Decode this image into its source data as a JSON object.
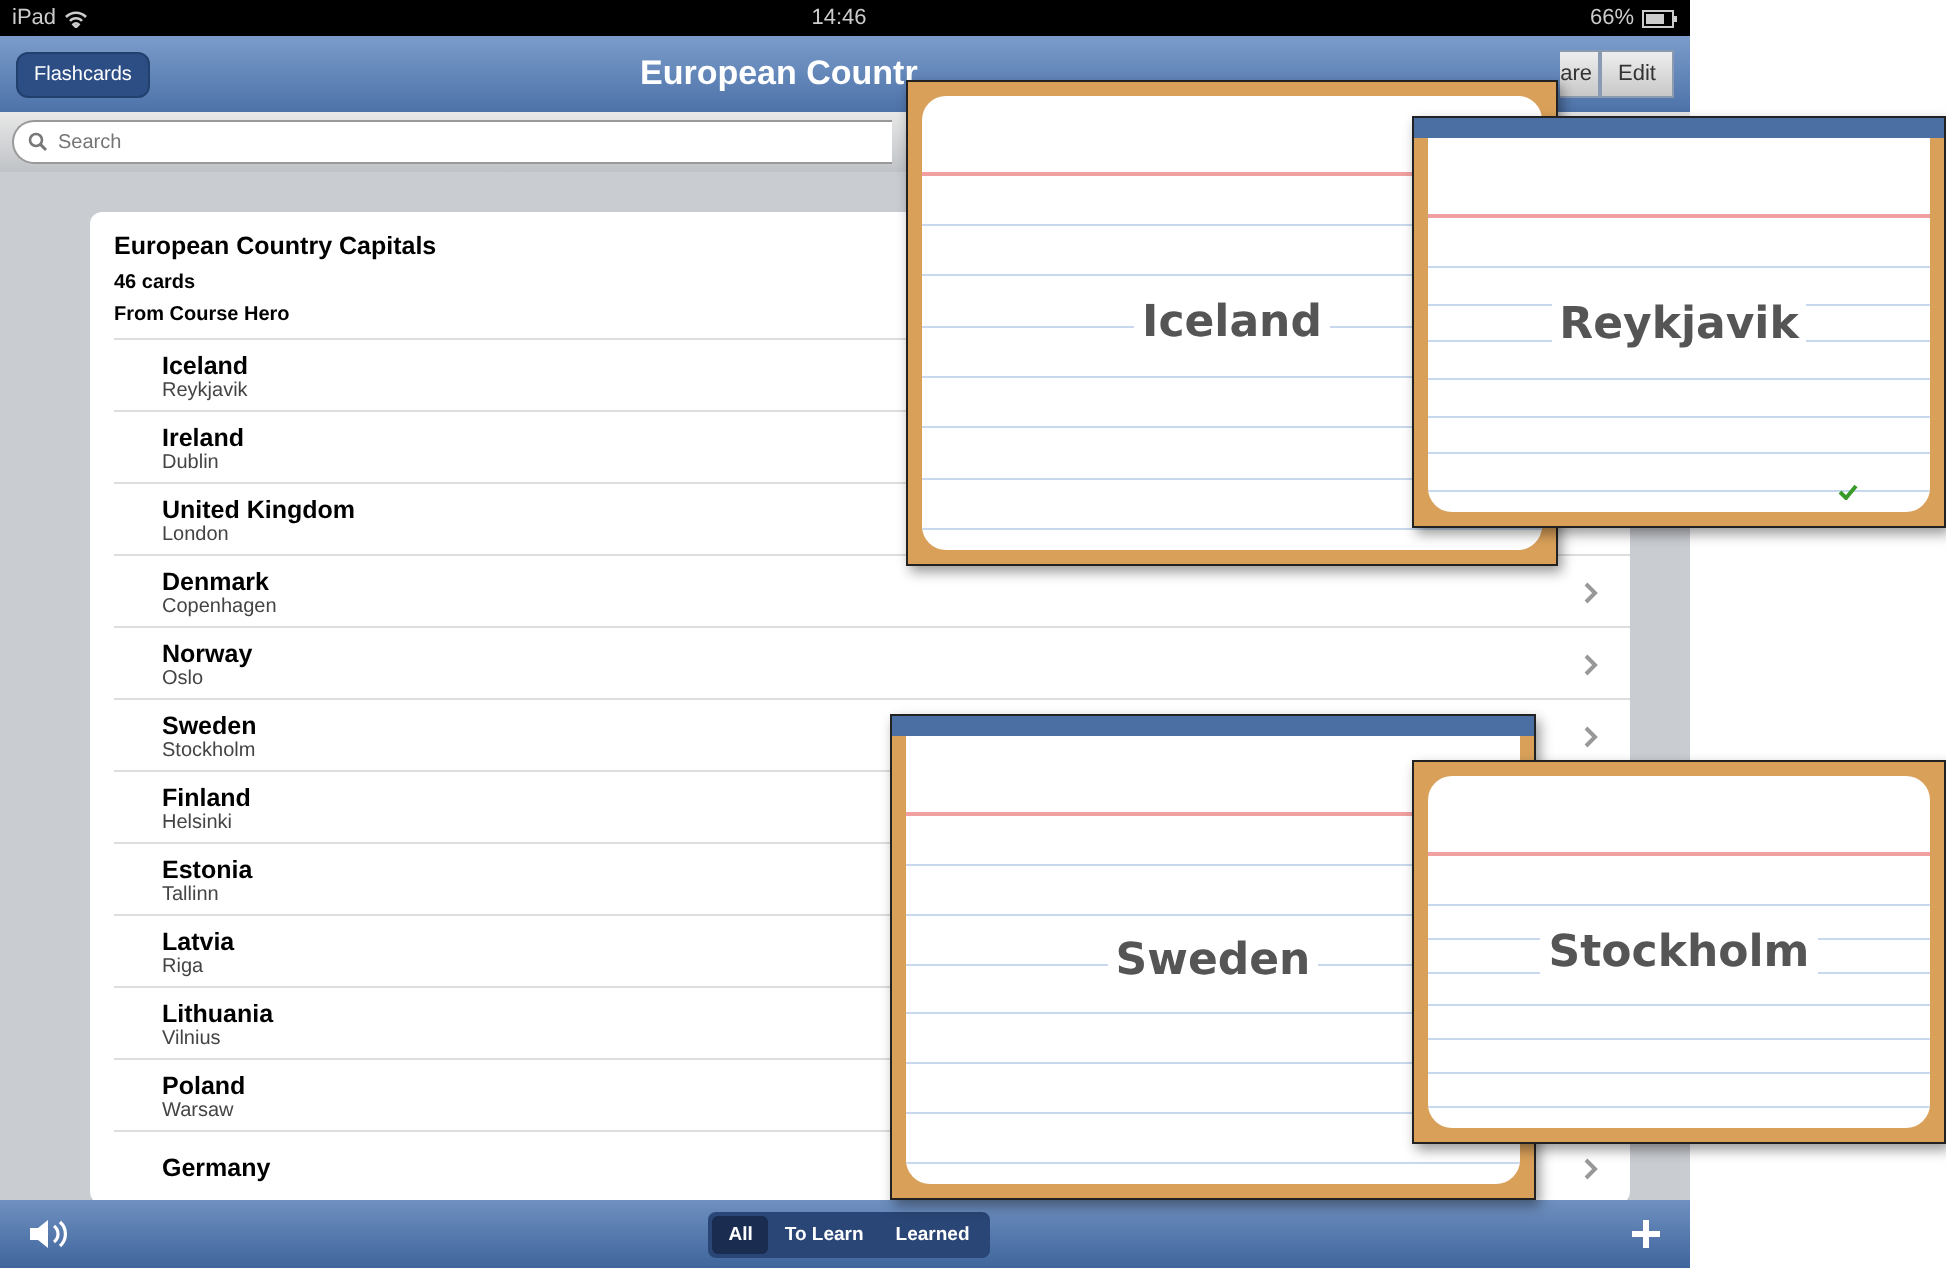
{
  "status_bar": {
    "device": "iPad",
    "time": "14:46",
    "battery": "66%"
  },
  "nav_bar": {
    "back_button": "Flashcards",
    "title": "European Countr",
    "buttons": [
      "are",
      "Edit"
    ]
  },
  "search": {
    "placeholder": "Search"
  },
  "deck": {
    "title": "European Country Capitals",
    "count": "46 cards",
    "source": "From Course Hero"
  },
  "cards": [
    {
      "front": "Iceland",
      "back": "Reykjavik"
    },
    {
      "front": "Ireland",
      "back": "Dublin"
    },
    {
      "front": "United Kingdom",
      "back": "London"
    },
    {
      "front": "Denmark",
      "back": "Copenhagen",
      "chevron": true
    },
    {
      "front": "Norway",
      "back": "Oslo",
      "chevron": true
    },
    {
      "front": "Sweden",
      "back": "Stockholm",
      "chevron": true
    },
    {
      "front": "Finland",
      "back": "Helsinki"
    },
    {
      "front": "Estonia",
      "back": "Tallinn"
    },
    {
      "front": "Latvia",
      "back": "Riga"
    },
    {
      "front": "Lithuania",
      "back": "Vilnius"
    },
    {
      "front": "Poland",
      "back": "Warsaw"
    },
    {
      "front": "Germany",
      "chevron": true
    }
  ],
  "toolbar": {
    "segments": [
      {
        "label": "All",
        "selected": true
      },
      {
        "label": "To Learn",
        "selected": false
      },
      {
        "label": "Learned",
        "selected": false
      }
    ]
  },
  "flashcards": [
    {
      "text": "Iceland",
      "kind": "card",
      "learned": false
    },
    {
      "text": "Reykjavik",
      "kind": "screen",
      "learned": true
    },
    {
      "text": "Sweden",
      "kind": "screen",
      "learned": false
    },
    {
      "text": "Stockholm",
      "kind": "card",
      "learned": false
    }
  ]
}
